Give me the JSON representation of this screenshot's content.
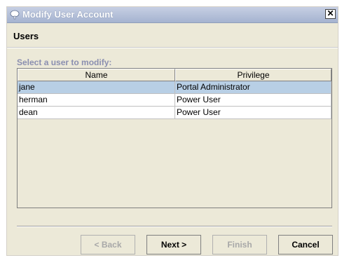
{
  "window": {
    "title": "Modify User Account",
    "close_glyph": "✕"
  },
  "page": {
    "heading": "Users",
    "instruction": "Select a user to modify:"
  },
  "table": {
    "columns": [
      "Name",
      "Privilege"
    ],
    "rows": [
      {
        "name": "jane",
        "privilege": "Portal Administrator",
        "selected": true
      },
      {
        "name": "herman",
        "privilege": "Power User",
        "selected": false
      },
      {
        "name": "dean",
        "privilege": "Power User",
        "selected": false
      }
    ]
  },
  "buttons": {
    "back": "< Back",
    "next": "Next >",
    "finish": "Finish",
    "cancel": "Cancel"
  },
  "colors": {
    "selection": "#b8cfe5",
    "titlebar": "#a5b3d0",
    "instruction": "#8b8fb0"
  }
}
